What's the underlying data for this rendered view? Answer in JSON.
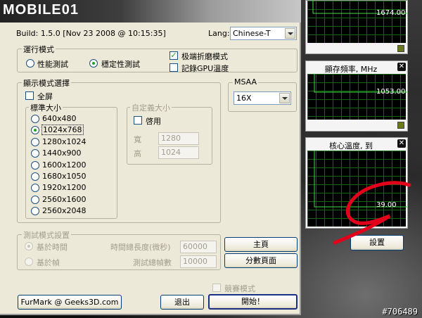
{
  "logo": "MOBILE01",
  "build": "Build: 1.5.0 [Nov 23 2008 @ 10:15:35]",
  "lang": {
    "label": "Lang:",
    "value": "Chinese-T"
  },
  "run_mode": {
    "title": "運行模式",
    "perf": "性能測試",
    "stability": "穩定性測試",
    "extreme": "极端折磨模式",
    "log_gpu": "記錄GPU溫度"
  },
  "display": {
    "title": "顯示模式選擇",
    "fullscreen": "全屏",
    "standard_title": "標準大小",
    "resolutions": [
      "640x480",
      "1024x768",
      "1280x1024",
      "1440x900",
      "1600x1200",
      "1680x1050",
      "1920x1200",
      "2560x1600",
      "2560x2048"
    ],
    "selected": "1024x768",
    "custom_title": "自定義大小",
    "enable": "啓用",
    "width_label": "寬",
    "width_value": "1280",
    "height_label": "高",
    "height_value": "1024"
  },
  "msaa": {
    "title": "MSAA",
    "value": "16X"
  },
  "test_settings": {
    "title": "測試模式設置",
    "by_time": "基於時間",
    "by_frames": "基於幀",
    "time_label": "時間總長度(微秒)",
    "time_value": "60000",
    "frames_label": "測試總幀數",
    "frames_value": "10000"
  },
  "buttons": {
    "home": "主頁",
    "scores": "分數頁面",
    "competition": "競賽模式",
    "furmark": "FurMark @ Geeks3D.com",
    "exit": "退出",
    "start": "開始！",
    "settings": "設置"
  },
  "monitors": [
    {
      "title": "",
      "value": "1674.00"
    },
    {
      "title": "顯存頻率, MHz",
      "value": "1053.00"
    },
    {
      "title": "核心溫度, 到",
      "value": "39.00"
    }
  ],
  "watermark": "#706489",
  "colors": {
    "accent_red": "#e3001b",
    "graph_line": "#3adf3a",
    "grid": "#0d6b0d"
  }
}
